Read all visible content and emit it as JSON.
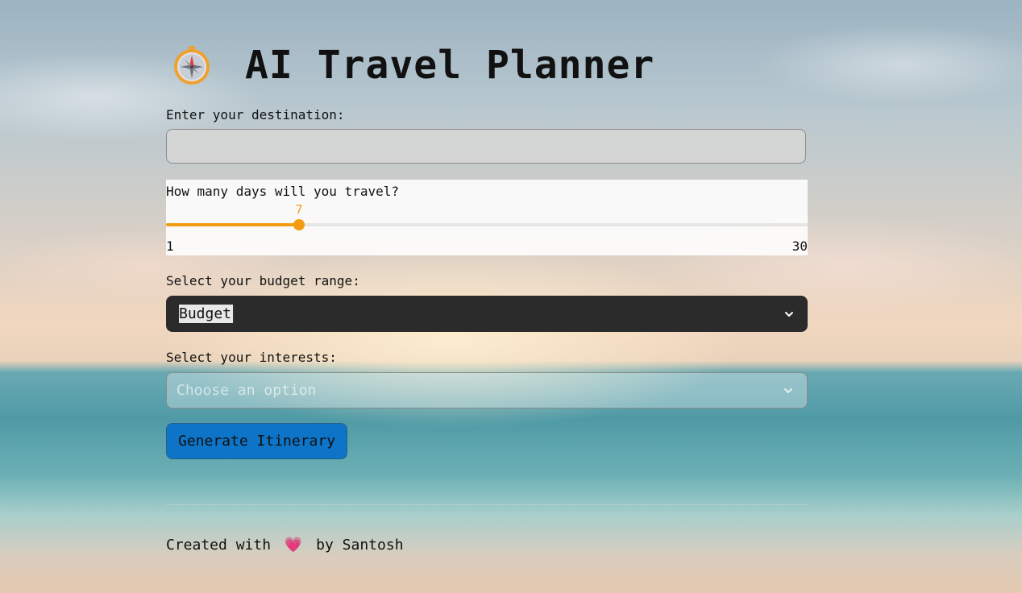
{
  "app": {
    "title": "AI Travel Planner",
    "title_icon": "compass-icon"
  },
  "destination": {
    "label": "Enter your destination:",
    "value": "",
    "placeholder": ""
  },
  "days": {
    "label": "How many days will you travel?",
    "min": 1,
    "max": 30,
    "value": 7,
    "min_label": "1",
    "max_label": "30",
    "value_label": "7",
    "accent_color": "#f39c12"
  },
  "budget": {
    "label": "Select your budget range:",
    "selected": "Budget",
    "icon": "chevron-down-icon"
  },
  "interests": {
    "label": "Select your interests:",
    "placeholder": "Choose an option",
    "icon": "chevron-down-icon"
  },
  "actions": {
    "generate_label": "Generate Itinerary",
    "generate_color": "#0e74c8"
  },
  "footer": {
    "prefix": "Created with",
    "heart": "💗",
    "suffix": "by Santosh"
  }
}
